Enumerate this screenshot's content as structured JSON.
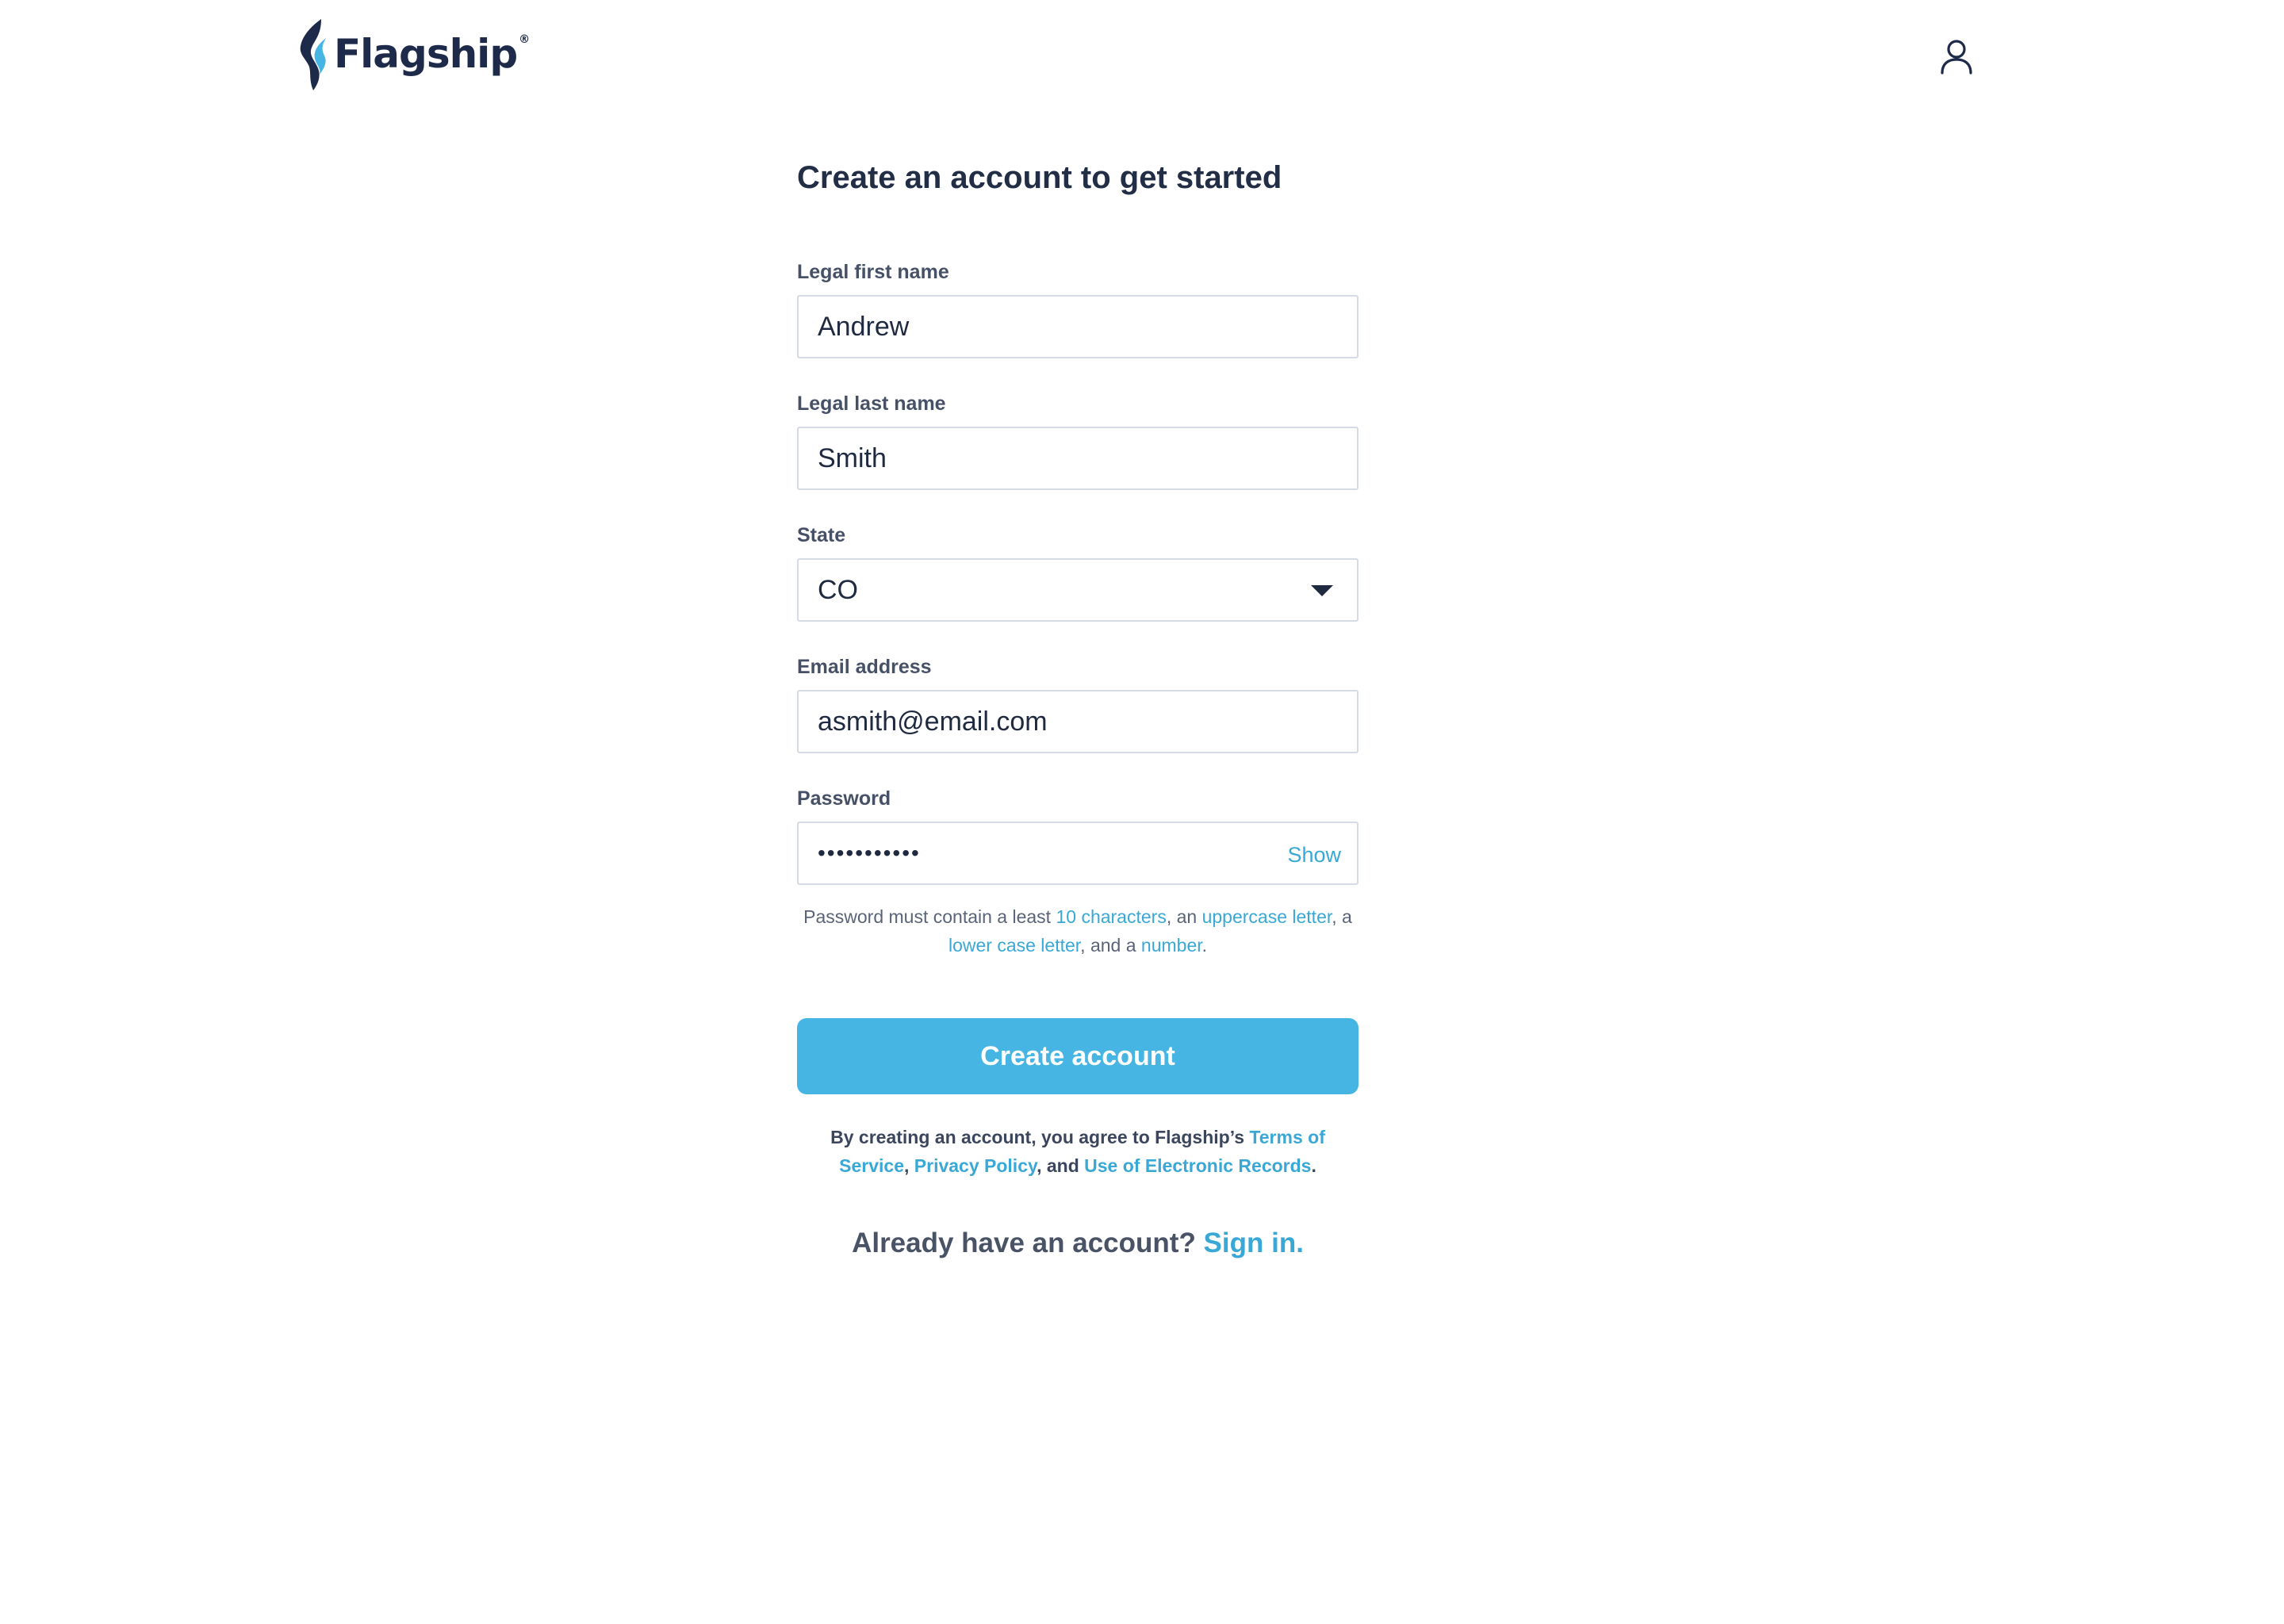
{
  "brand": {
    "name": "Flagship",
    "registered_mark": "®",
    "colors": {
      "navy": "#1e2a4a",
      "accent": "#46b5e3",
      "link": "#3aa8d6"
    }
  },
  "header": {
    "account_icon": "user-outline-icon"
  },
  "form": {
    "title": "Create an account to get started",
    "first_name": {
      "label": "Legal first name",
      "value": "Andrew"
    },
    "last_name": {
      "label": "Legal last name",
      "value": "Smith"
    },
    "state": {
      "label": "State",
      "value": "CO",
      "icon": "caret-down-icon"
    },
    "email": {
      "label": "Email address",
      "value": "asmith@email.com"
    },
    "password": {
      "label": "Password",
      "masked_value": "•••••••••••",
      "show_label": "Show"
    },
    "password_hint": {
      "t1": "Password must contain a least ",
      "r1": "10 characters",
      "t2": ", an ",
      "r2": "uppercase letter",
      "t3": ", a ",
      "r3": "lower case letter",
      "t4": ", and a ",
      "r4": "number",
      "t5": "."
    },
    "submit_label": "Create account",
    "terms": {
      "t1": "By creating an account, you agree to Flagship’s ",
      "tos": "Terms of Service",
      "t2": ", ",
      "privacy": "Privacy Policy",
      "t3": ", and ",
      "records": "Use of Electronic Records",
      "t4": "."
    },
    "signin": {
      "prompt": "Already have an account? ",
      "link": "Sign in."
    }
  }
}
